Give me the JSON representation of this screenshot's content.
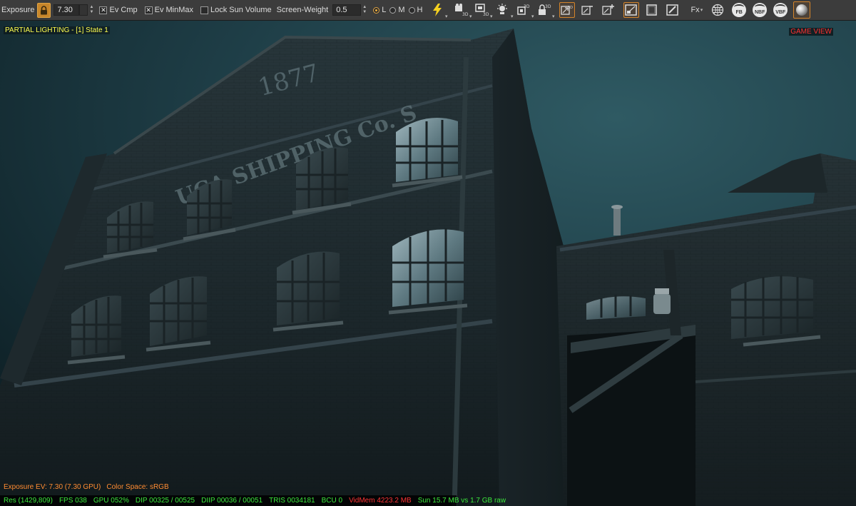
{
  "toolbar": {
    "exposure_label": "Exposure",
    "exposure_value": "7.30",
    "ev_cmp_label": "Ev Cmp",
    "ev_minmax_label": "Ev MinMax",
    "lock_sun_label": "Lock Sun Volume",
    "screen_weight_label": "Screen-Weight",
    "screen_weight_value": "0.5",
    "quality_options": [
      "L",
      "M",
      "H"
    ],
    "quality_selected": "L",
    "fx_label": "Fx",
    "fb_label": "FB",
    "nbf_label": "NBF",
    "vbf_label": "VBF",
    "accent_color": "#d4842a"
  },
  "viewport": {
    "mode_label": "PARTIAL LIGHTING - [1] State 1",
    "game_view_label": "GAME VIEW",
    "sign_year": "1877",
    "sign_text": "UCA SHIPPING Co. S",
    "exposure_readout": "Exposure EV: 7.30 (7.30 GPU)",
    "color_space": "Color Space: sRGB"
  },
  "stats": {
    "res": "Res (1429,809)",
    "fps": "FPS 038",
    "gpu": "GPU 052%",
    "dip": "DIP 00325 / 00525",
    "diip": "DIIP 00036 / 00051",
    "tris": "TRIS 0034181",
    "bcu": "BCU 0",
    "vidmem": "VidMem 4223.2 MB",
    "sun": "Sun 15.7 MB vs 1.7 GB raw"
  }
}
